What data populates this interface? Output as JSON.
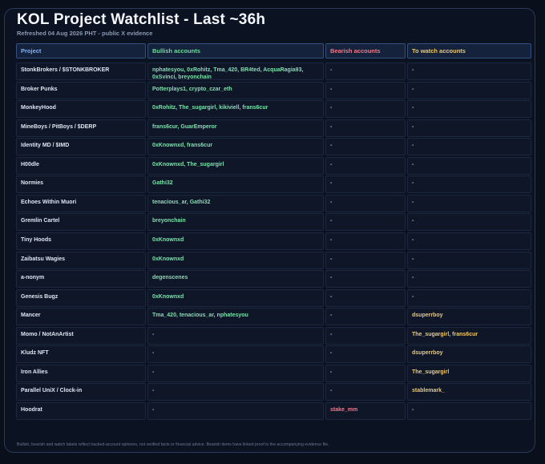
{
  "page": {
    "title": "KOL Project Watchlist - Last ~36h",
    "subtitle": "Refreshed 04 Aug 2026 PHT - public X evidence",
    "footer": "Bullish, bearish and watch labels reflect tracked-account opinions, not verified facts or financial advice. Bearish items have linked proof in the accompanying evidence file."
  },
  "table": {
    "headers": [
      "Project",
      "Bullish accounts",
      "Bearish accounts",
      "To watch accounts"
    ],
    "rows": [
      {
        "project": "StonkBrokers / $STONKBROKER",
        "bullish": "nphatesyou, 0xRohitz, Tma_420, BR4ted, AcquaRagia93, 0xSvinci, breyonchain",
        "bearish": "-",
        "watch": "-"
      },
      {
        "project": "Broker Punks",
        "bullish": "Potterplays1, crypto_czar_eth",
        "bearish": "-",
        "watch": "-"
      },
      {
        "project": "MonkeyHood",
        "bullish": "0xRohitz, The_sugargirl, kikiviell, frans6cur",
        "bearish": "-",
        "watch": "-"
      },
      {
        "project": "MineBoys / PitBoys / $DERP",
        "bullish": "frans6cur, GuarEmperor",
        "bearish": "-",
        "watch": "-"
      },
      {
        "project": "Identity MD / $IMD",
        "bullish": "0xKnownxd, frans6cur",
        "bearish": "-",
        "watch": "-"
      },
      {
        "project": "H00dle",
        "bullish": "0xKnownxd, The_sugargirl",
        "bearish": "-",
        "watch": "-"
      },
      {
        "project": "Normies",
        "bullish": "Gathi32",
        "bearish": "-",
        "watch": "-"
      },
      {
        "project": "Echoes Within Muori",
        "bullish": "tenacious_ar, Gathi32",
        "bearish": "-",
        "watch": "-"
      },
      {
        "project": "Gremlin Cartel",
        "bullish": "breyonchain",
        "bearish": "-",
        "watch": "-"
      },
      {
        "project": "Tiny Hoods",
        "bullish": "0xKnownxd",
        "bearish": "-",
        "watch": "-"
      },
      {
        "project": "Zaibatsu Wagies",
        "bullish": "0xKnownxd",
        "bearish": "-",
        "watch": "-"
      },
      {
        "project": "a-nonym",
        "bullish": "degenscenes",
        "bearish": "-",
        "watch": "-"
      },
      {
        "project": "Genesis Bugz",
        "bullish": "0xKnownxd",
        "bearish": "-",
        "watch": "-"
      },
      {
        "project": "Mancer",
        "bullish": "Tma_420, tenacious_ar, nphatesyou",
        "bearish": "-",
        "watch": "dsuperrboy"
      },
      {
        "project": "Momo / NotAnArtist",
        "bullish": "-",
        "bearish": "-",
        "watch": "The_sugargirl, frans6cur"
      },
      {
        "project": "Kludz NFT",
        "bullish": "-",
        "bearish": "-",
        "watch": "dsuperrboy"
      },
      {
        "project": "Iron Allies",
        "bullish": "-",
        "bearish": "-",
        "watch": "The_sugargirl"
      },
      {
        "project": "Parallel UniX / Clock-in",
        "bullish": "-",
        "bearish": "-",
        "watch": "stablemark_"
      },
      {
        "project": "Hoodrat",
        "bullish": "-",
        "bearish": "stake_mm",
        "watch": "-"
      }
    ]
  },
  "colors": {
    "background": "#0a0f1c",
    "bullish": "#7fe0ad",
    "bearish": "#f37a8c",
    "watch": "#f0c86a",
    "project_header": "#7fb4ff"
  }
}
